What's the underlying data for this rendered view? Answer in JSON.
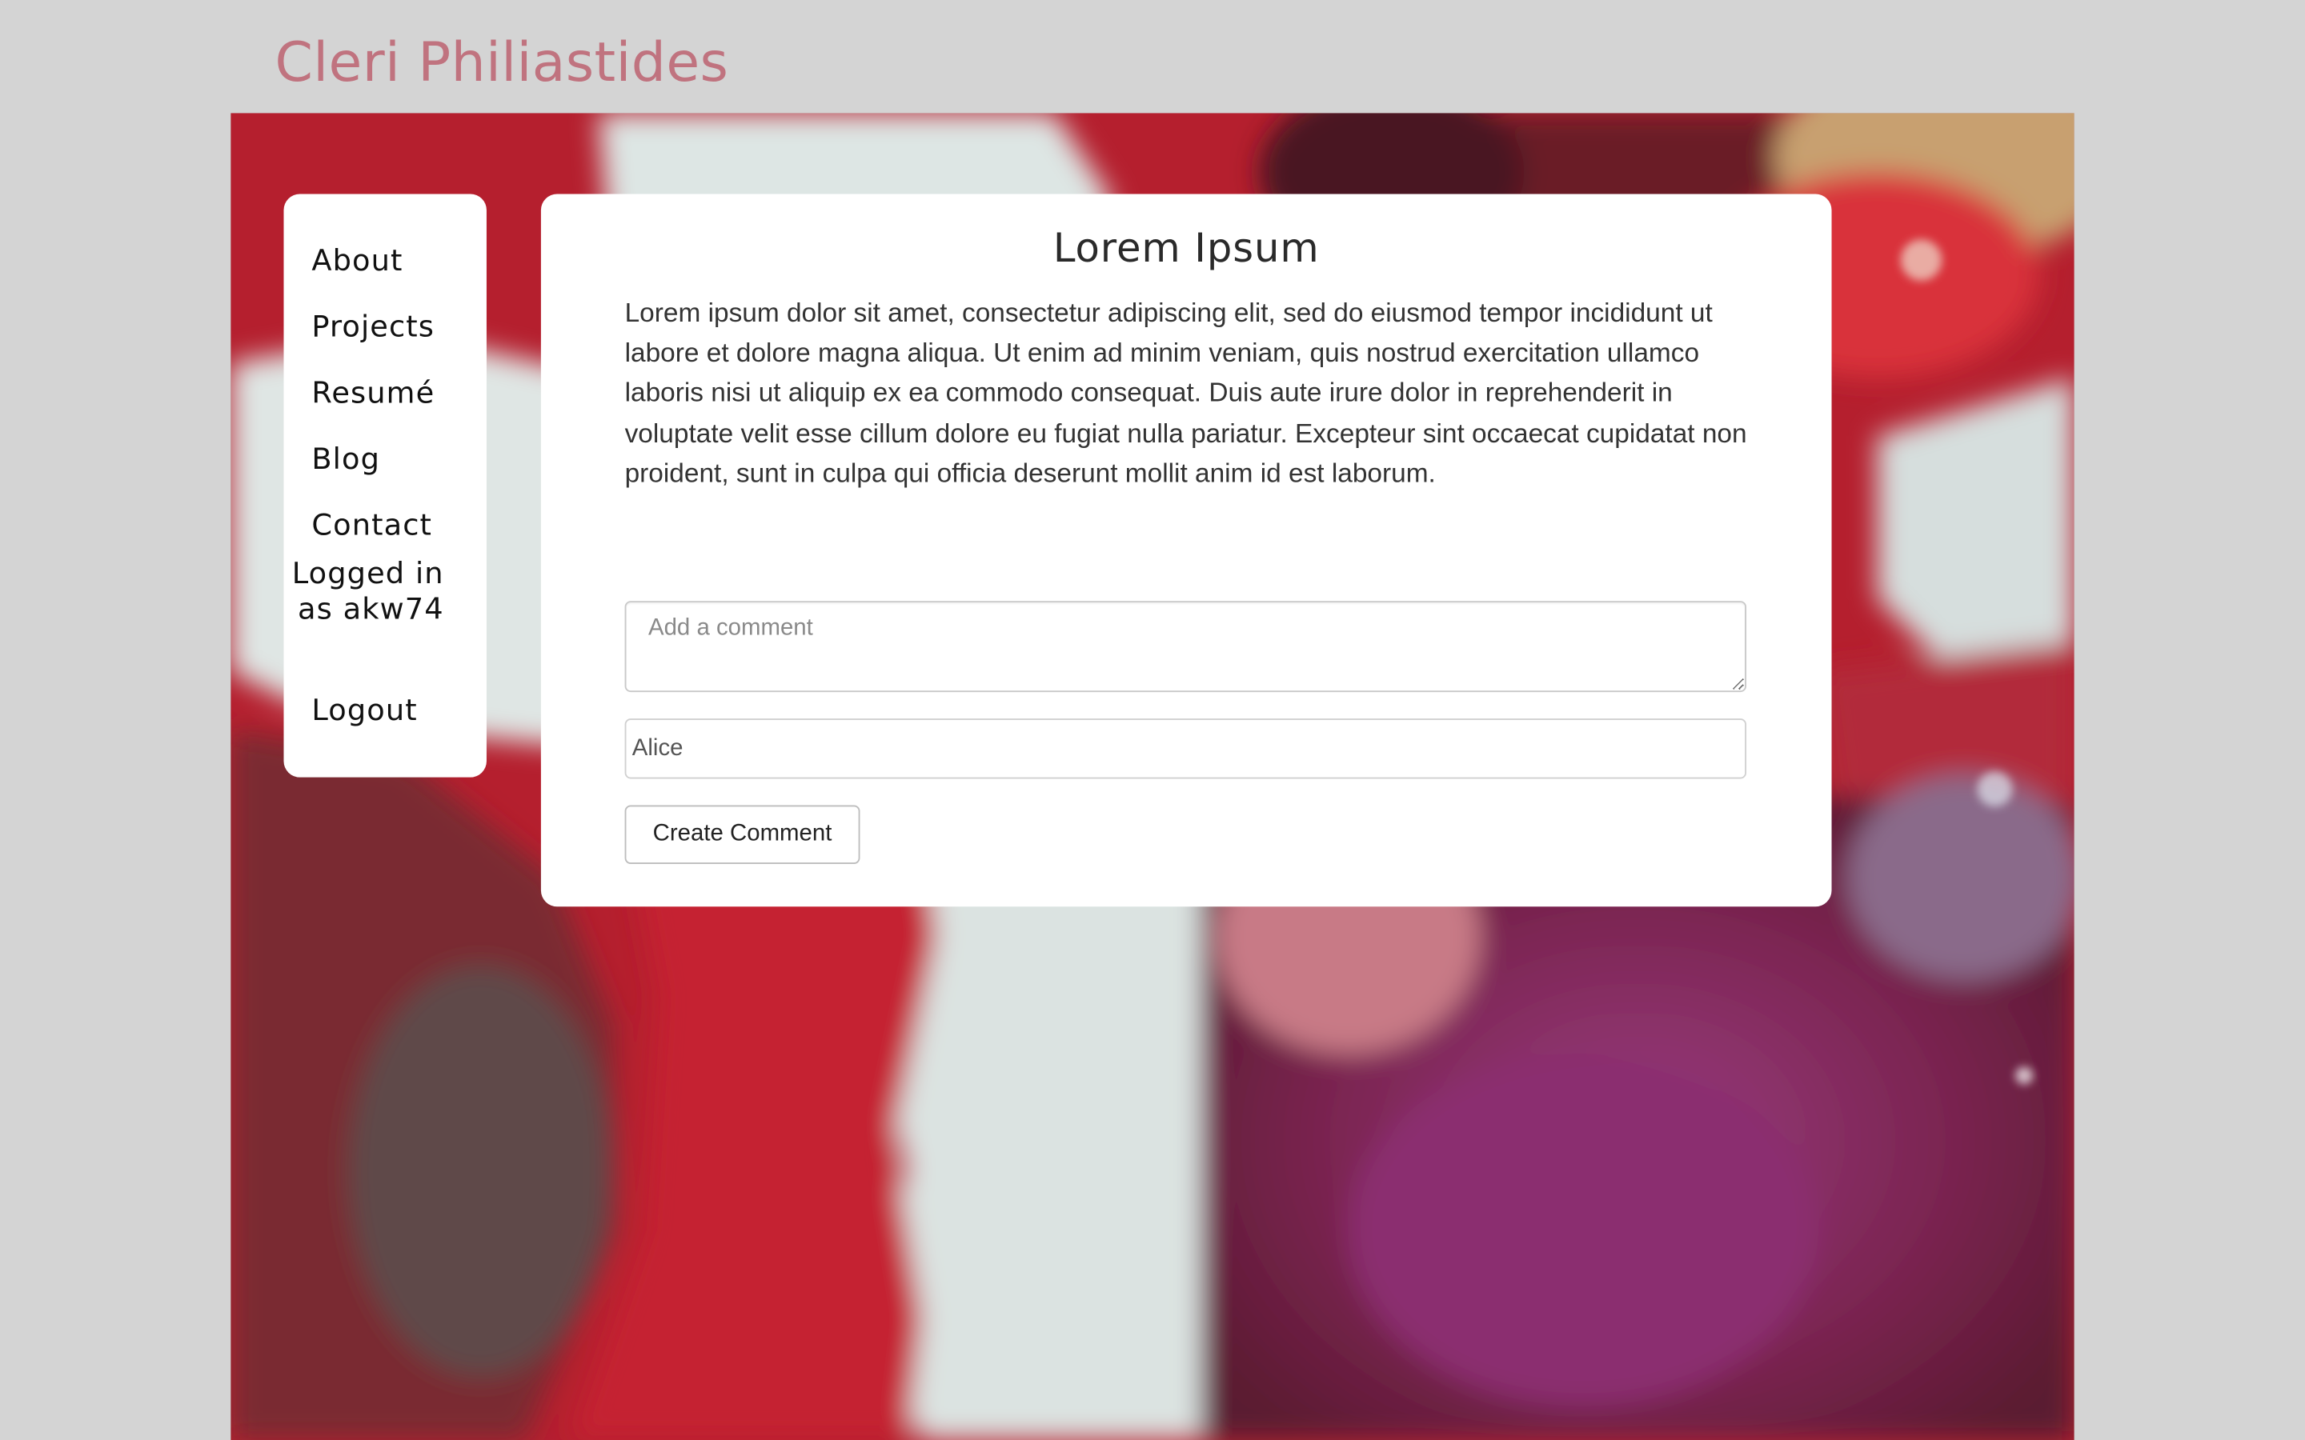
{
  "site": {
    "title": "Cleri Philiastides"
  },
  "nav": {
    "items": [
      {
        "label": "About"
      },
      {
        "label": "Projects"
      },
      {
        "label": "Resumé"
      },
      {
        "label": "Blog"
      },
      {
        "label": "Contact"
      }
    ],
    "logged_in_text": "Logged in as akw74",
    "logout_label": "Logout"
  },
  "post": {
    "title": "Lorem Ipsum",
    "body": "Lorem ipsum dolor sit amet, consectetur adipiscing elit, sed do eiusmod tempor incididunt ut labore et dolore magna aliqua. Ut enim ad minim veniam, quis nostrud exercitation ullamco laboris nisi ut aliquip ex ea commodo consequat. Duis aute irure dolor in reprehenderit in voluptate velit esse cillum dolore eu fugiat nulla pariatur. Excepteur sint occaecat cupidatat non proident, sunt in culpa qui officia deserunt mollit anim id est laborum."
  },
  "comment_form": {
    "comment_placeholder": "Add a comment",
    "comment_value": "",
    "name_value": "Alice",
    "submit_label": "Create Comment"
  },
  "colors": {
    "page_background": "#d4d4d4",
    "title_accent": "#c0737f",
    "card_background": "#ffffff"
  }
}
